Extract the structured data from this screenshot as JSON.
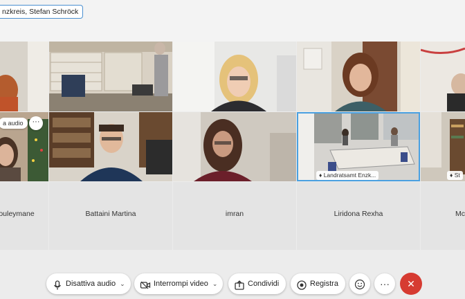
{
  "header": {
    "participants_chip": "nzkreis, Stefan Schröck"
  },
  "tiles_row2": {
    "audio_pill": "a audio",
    "more_label": "···",
    "landratsamt_badge": "Landratsamt Enzk...",
    "last_badge": "St"
  },
  "names": [
    "ouleymane",
    "Battaini Martina",
    "imran",
    "Liridona Rexha",
    "Mc"
  ],
  "toolbar": {
    "mute_label": "Disattiva audio",
    "video_label": "Interrompi video",
    "share_label": "Condividi",
    "record_label": "Registra",
    "more_label": "···",
    "end_label": "✕"
  },
  "icons": [
    "microphone-icon",
    "video-camera-icon",
    "share-icon",
    "record-icon",
    "emoji-icon",
    "more-icon",
    "close-icon",
    "chevron-down-icon",
    "speaker-icon"
  ],
  "colors": {
    "accent": "#4a8fd0",
    "end_call": "#d63b31"
  }
}
